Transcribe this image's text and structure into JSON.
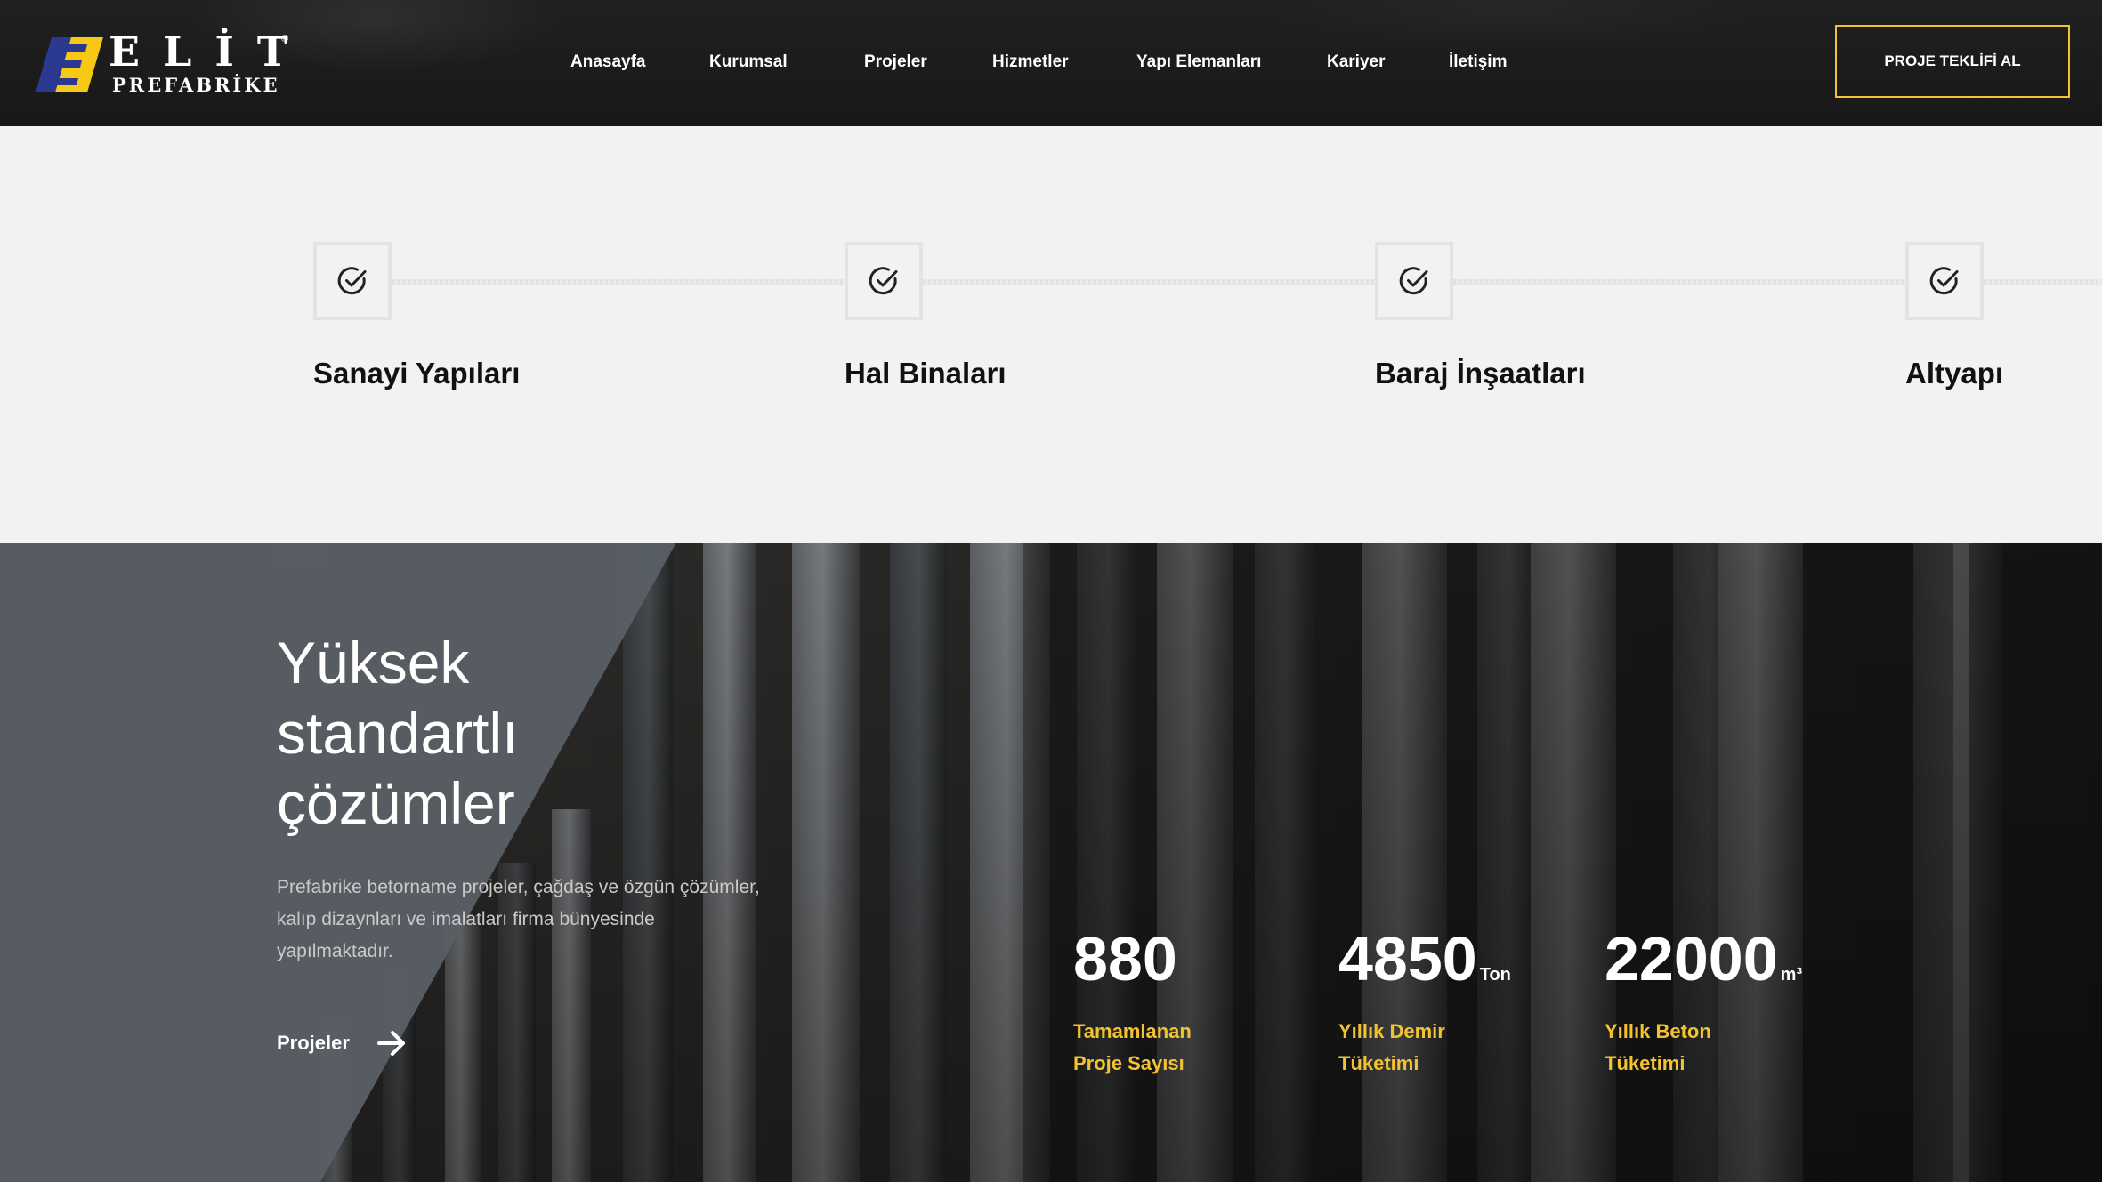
{
  "brand": {
    "name": "ELİT",
    "tagline": "PREFABRİKE",
    "reg_mark": "®",
    "accent": "#f2c230",
    "logo_blue": "#2b3990",
    "logo_yellow": "#f7c814"
  },
  "nav": {
    "items": [
      "Anasayfa",
      "Kurumsal",
      "Projeler",
      "Hizmetler",
      "Yapı Elemanları",
      "Kariyer",
      "İletişim"
    ],
    "cta_label": "PROJE TEKLİFİ AL"
  },
  "features": [
    {
      "title": "Sanayi Yapıları",
      "icon": "check-circle-icon"
    },
    {
      "title": "Hal Binaları",
      "icon": "check-circle-icon"
    },
    {
      "title": "Baraj İnşaatları",
      "icon": "check-circle-icon"
    },
    {
      "title": "Altyapı",
      "icon": "check-circle-icon"
    }
  ],
  "hero": {
    "title_lines": [
      "Yüksek",
      "standartlı",
      "çözümler"
    ],
    "description": "Prefabrike betorname projeler, çağdaş ve özgün çözümler, kalıp dizaynları ve imalatları firma bünyesinde yapılmaktadır.",
    "link_label": "Projeler",
    "link_icon": "arrow-right-icon"
  },
  "stats": [
    {
      "value": "880",
      "unit": "",
      "label_lines": [
        "Tamamlanan",
        "Proje Sayısı"
      ]
    },
    {
      "value": "4850",
      "unit": "Ton",
      "label_lines": [
        "Yıllık Demir",
        "Tüketimi"
      ]
    },
    {
      "value": "22000",
      "unit": "m³",
      "label_lines": [
        "Yıllık Beton",
        "Tüketimi"
      ]
    }
  ]
}
